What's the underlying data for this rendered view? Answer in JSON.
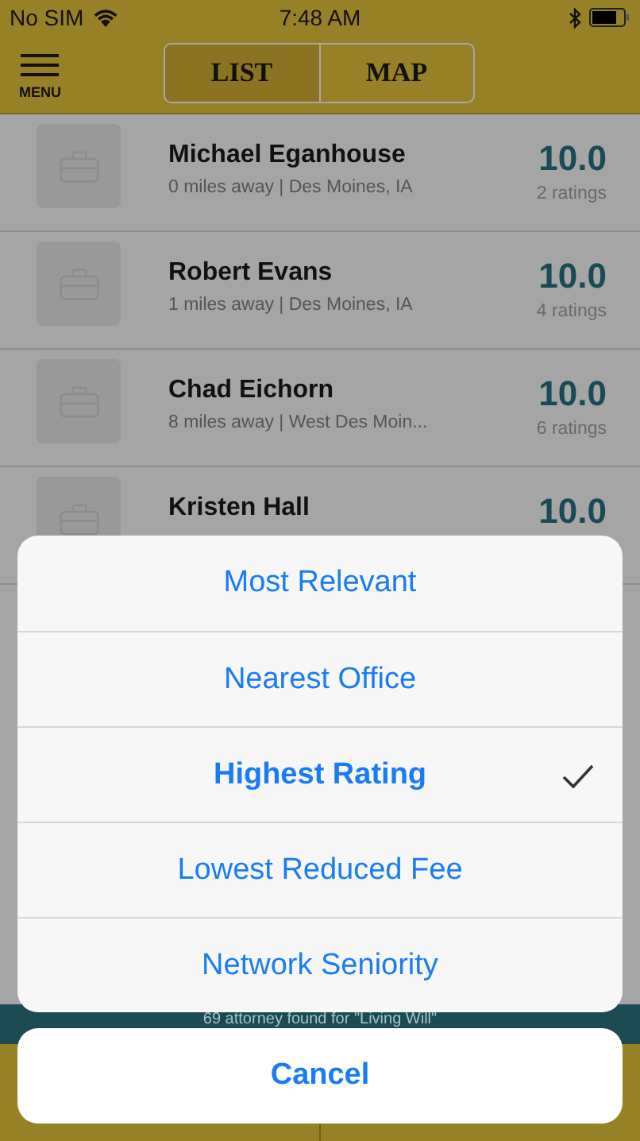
{
  "status_bar": {
    "carrier": "No SIM",
    "time": "7:48 AM"
  },
  "nav": {
    "menu_label": "MENU",
    "tabs": [
      {
        "label": "LIST",
        "selected": true
      },
      {
        "label": "MAP",
        "selected": false
      }
    ]
  },
  "attorneys": [
    {
      "name": "Michael Eganhouse",
      "detail": "0 miles away | Des Moines, IA",
      "score": "10.0",
      "ratings": "2 ratings"
    },
    {
      "name": "Robert Evans",
      "detail": "1 miles away | Des Moines, IA",
      "score": "10.0",
      "ratings": "4 ratings"
    },
    {
      "name": "Chad Eichorn",
      "detail": "8 miles away | West Des Moin...",
      "score": "10.0",
      "ratings": "6 ratings"
    },
    {
      "name": "Kristen Hall",
      "score": "10.0"
    }
  ],
  "results_bar": "69 attorney found for \"Living Will\"",
  "sort_sheet": {
    "options": [
      {
        "label": "Most Relevant",
        "selected": false
      },
      {
        "label": "Nearest Office",
        "selected": false
      },
      {
        "label": "Highest Rating",
        "selected": true
      },
      {
        "label": "Lowest Reduced Fee",
        "selected": false
      },
      {
        "label": "Network Seniority",
        "selected": false
      }
    ],
    "cancel": "Cancel"
  }
}
